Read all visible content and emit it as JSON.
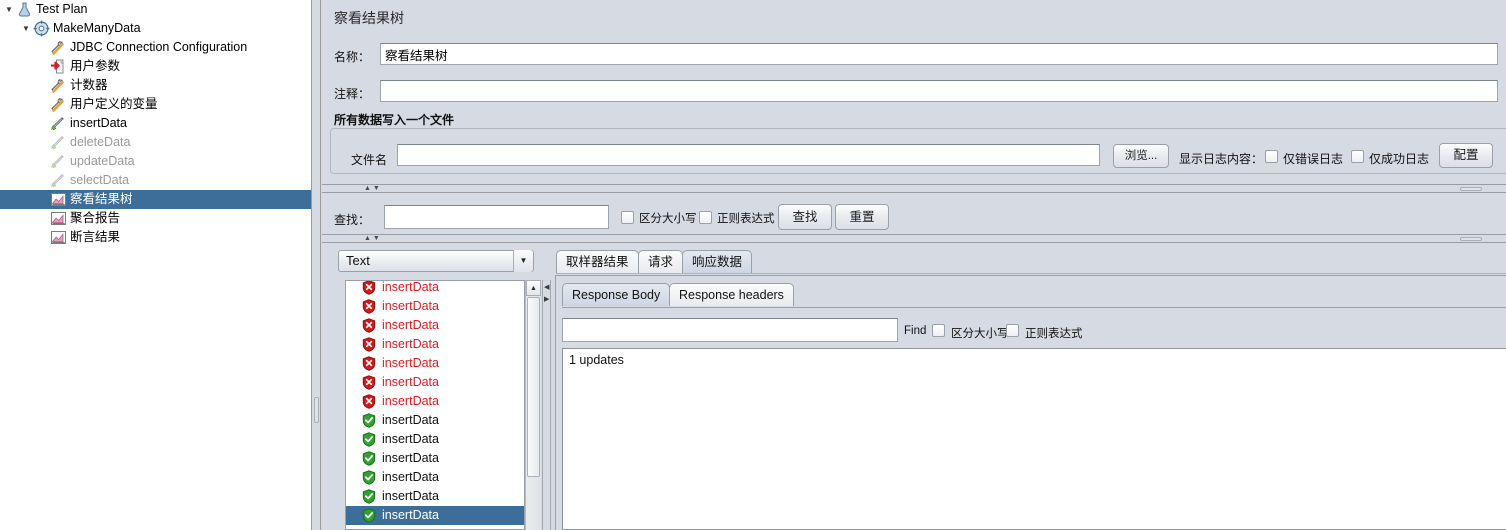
{
  "app": {
    "accent_selection": "#3c6e99",
    "error_color": "#e01b24",
    "panel_bg": "#d6dae2"
  },
  "tree": {
    "items": [
      {
        "label": "Test Plan",
        "indent": 0,
        "icon": "test-plan-icon",
        "twisty": "▼",
        "state": "normal"
      },
      {
        "label": "MakeManyData",
        "indent": 1,
        "icon": "thread-group-icon",
        "twisty": "▼",
        "state": "normal"
      },
      {
        "label": "JDBC Connection Configuration",
        "indent": 2,
        "icon": "config-element-icon",
        "twisty": "",
        "state": "normal"
      },
      {
        "label": "用户参数",
        "indent": 2,
        "icon": "user-parameters-icon",
        "twisty": "",
        "state": "normal"
      },
      {
        "label": "计数器",
        "indent": 2,
        "icon": "config-element-icon",
        "twisty": "",
        "state": "normal"
      },
      {
        "label": "用户定义的变量",
        "indent": 2,
        "icon": "config-element-icon",
        "twisty": "",
        "state": "normal"
      },
      {
        "label": "insertData",
        "indent": 2,
        "icon": "jdbc-request-icon",
        "twisty": "",
        "state": "normal"
      },
      {
        "label": "deleteData",
        "indent": 2,
        "icon": "jdbc-request-icon",
        "twisty": "",
        "state": "disabled"
      },
      {
        "label": "updateData",
        "indent": 2,
        "icon": "jdbc-request-icon",
        "twisty": "",
        "state": "disabled"
      },
      {
        "label": "selectData",
        "indent": 2,
        "icon": "jdbc-request-icon",
        "twisty": "",
        "state": "disabled"
      },
      {
        "label": "察看结果树",
        "indent": 2,
        "icon": "view-results-tree-icon",
        "twisty": "",
        "state": "selected"
      },
      {
        "label": "聚合报告",
        "indent": 2,
        "icon": "aggregate-report-icon",
        "twisty": "",
        "state": "normal"
      },
      {
        "label": "断言结果",
        "indent": 2,
        "icon": "assertion-results-icon",
        "twisty": "",
        "state": "normal"
      }
    ]
  },
  "main": {
    "title": "察看结果树",
    "name_label": "名称：",
    "name_value": "察看结果树",
    "comment_label": "注释：",
    "comment_value": "",
    "group_title": "所有数据写入一个文件",
    "filename_label": "文件名",
    "filename_value": "",
    "browse_button": "浏览...",
    "log_display_label": "显示日志内容：",
    "errors_only_label": "仅错误日志",
    "success_only_label": "仅成功日志",
    "configure_button": "配置"
  },
  "search": {
    "label": "查找：",
    "value": "",
    "case_sensitive_label": "区分大小写",
    "regex_label": "正则表达式",
    "find_button": "查找",
    "reset_button": "重置"
  },
  "renderer": {
    "selected": "Text"
  },
  "results": {
    "rows": [
      {
        "label": "insertData",
        "status": "error",
        "selected": false
      },
      {
        "label": "insertData",
        "status": "error",
        "selected": false
      },
      {
        "label": "insertData",
        "status": "error",
        "selected": false
      },
      {
        "label": "insertData",
        "status": "error",
        "selected": false
      },
      {
        "label": "insertData",
        "status": "error",
        "selected": false
      },
      {
        "label": "insertData",
        "status": "error",
        "selected": false
      },
      {
        "label": "insertData",
        "status": "error",
        "selected": false
      },
      {
        "label": "insertData",
        "status": "success",
        "selected": false
      },
      {
        "label": "insertData",
        "status": "success",
        "selected": false
      },
      {
        "label": "insertData",
        "status": "success",
        "selected": false
      },
      {
        "label": "insertData",
        "status": "success",
        "selected": false
      },
      {
        "label": "insertData",
        "status": "success",
        "selected": false
      },
      {
        "label": "insertData",
        "status": "success",
        "selected": true
      }
    ]
  },
  "result_tabs": {
    "items": [
      {
        "label": "取样器结果",
        "active": false
      },
      {
        "label": "请求",
        "active": false
      },
      {
        "label": "响应数据",
        "active": true
      }
    ]
  },
  "response_tabs": {
    "items": [
      {
        "label": "Response Body",
        "active": true
      },
      {
        "label": "Response headers",
        "active": false
      }
    ]
  },
  "response_find": {
    "value": "",
    "find_label": "Find",
    "case_sensitive_label": "区分大小写",
    "regex_label": "正则表达式"
  },
  "response_body": {
    "text": "1 updates"
  }
}
